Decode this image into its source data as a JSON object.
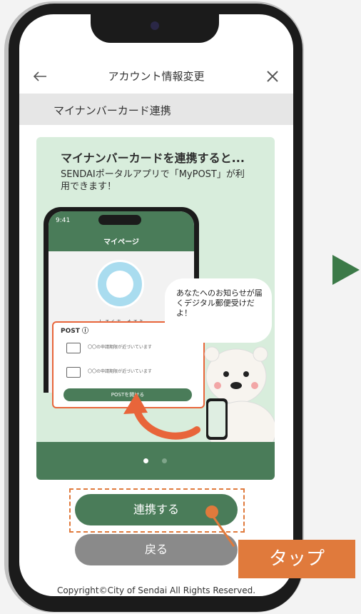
{
  "header": {
    "title": "アカウント情報変更",
    "back_icon": "arrow-left-icon",
    "close_icon": "close-icon"
  },
  "section": {
    "label": "マイナンバーカード連携"
  },
  "card": {
    "heading": "マイナンバーカードを連携すると...",
    "body": "SENDAIポータルアプリで「MyPOST」が利用できます！",
    "mini_phone": {
      "time": "9:41",
      "nav_title": "マイページ",
      "user_name": "しろくま　たろう",
      "post_label": "POST ⓘ",
      "rows": [
        "〇〇の申請期限が近づいています",
        "〇〇の申請期限が近づいています"
      ],
      "post_button": "POSTを開ける"
    },
    "bubble": "あなたへのお知らせが届くデジタル郵便受けだよ！",
    "carousel": {
      "total": 2,
      "active": 1
    }
  },
  "buttons": {
    "connect": "連携する",
    "back": "戻る"
  },
  "footer": {
    "copyright": "Copyright©City of Sendai All Rights Reserved."
  },
  "annotation": {
    "tap": "タップ"
  },
  "colors": {
    "brand_green": "#4a7c59",
    "accent_orange": "#e07a3c",
    "card_bg": "#d8eddc"
  }
}
